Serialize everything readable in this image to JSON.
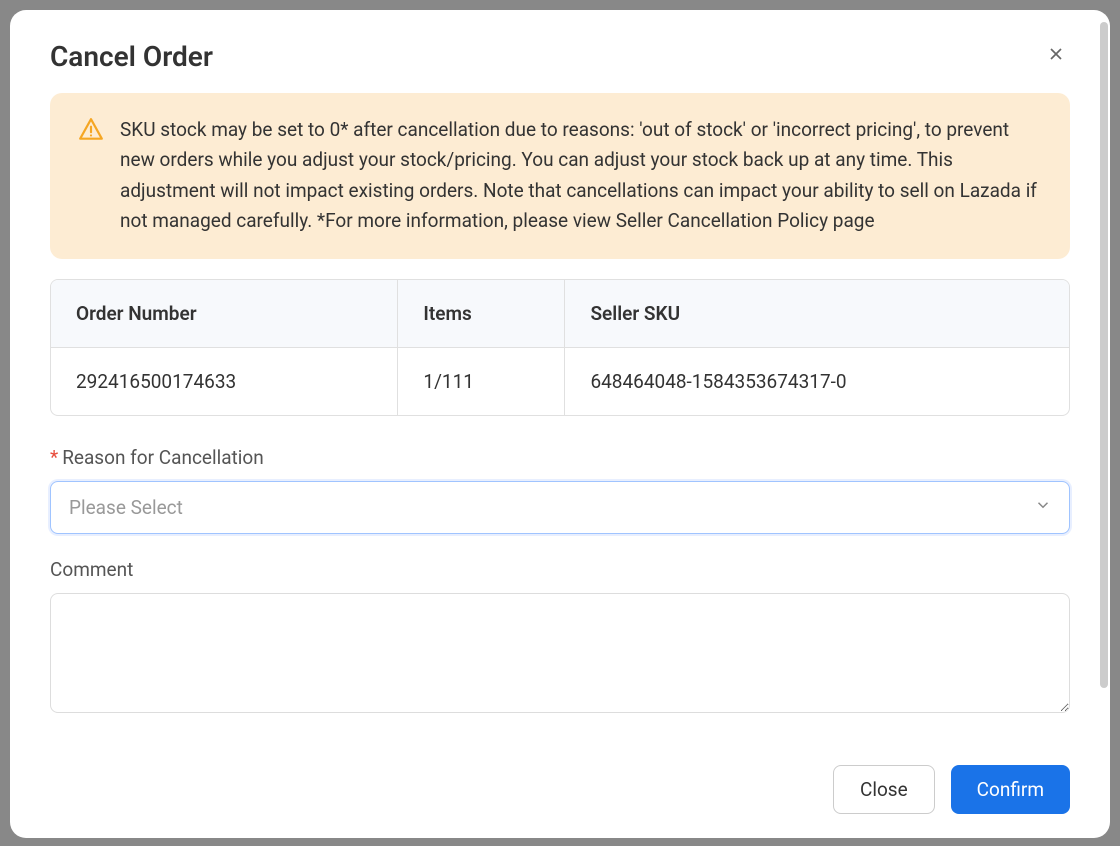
{
  "modal": {
    "title": "Cancel Order",
    "warning": "SKU stock may be set to 0* after cancellation due to reasons: 'out of stock' or 'incorrect pricing', to prevent new orders while you adjust your stock/pricing. You can adjust your stock back up at any time. This adjustment will not impact existing orders. Note that cancellations can impact your ability to sell on Lazada if not managed carefully. *For more information, please view Seller Cancellation Policy page"
  },
  "table": {
    "headers": {
      "order_number": "Order Number",
      "items": "Items",
      "seller_sku": "Seller SKU"
    },
    "row": {
      "order_number": "292416500174633",
      "items": "1/111",
      "seller_sku": "648464048-1584353674317-0"
    }
  },
  "form": {
    "reason_label": "Reason for Cancellation",
    "reason_placeholder": "Please Select",
    "comment_label": "Comment"
  },
  "footer": {
    "close": "Close",
    "confirm": "Confirm"
  }
}
